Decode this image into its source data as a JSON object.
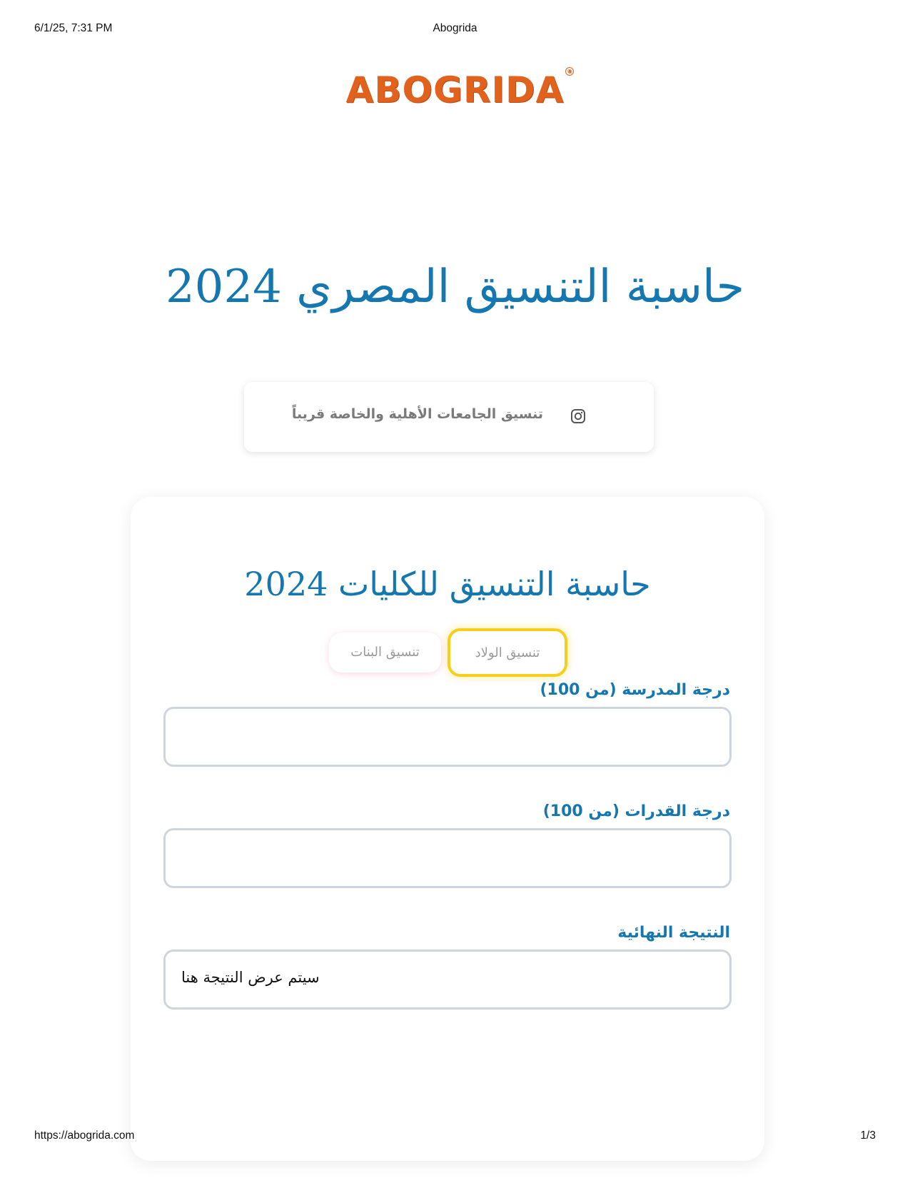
{
  "print_header": {
    "date": "6/1/25, 7:31 PM",
    "title": "Abogrida"
  },
  "print_footer": {
    "url": "https://abogrida.com",
    "page": "1/3"
  },
  "logo": {
    "text": "ABOGRIDA",
    "reg_mark": "®",
    "color": "#e0621d"
  },
  "hero": {
    "title": "حاسبة التنسيق المصري 2024"
  },
  "notice": {
    "text": "تنسيق الجامعات الأهلية والخاصة قريباً",
    "icon": "instagram-icon"
  },
  "calculator": {
    "title": "حاسبة التنسيق للكليات 2024",
    "tabs": [
      {
        "label": "تنسيق الولاد",
        "active": true
      },
      {
        "label": "تنسيق البنات",
        "active": false
      }
    ],
    "school_score": {
      "label": "درجة المدرسة (من 100)",
      "value": ""
    },
    "aptitude_score": {
      "label": "درجة القدرات (من 100)",
      "value": ""
    },
    "result": {
      "label": "النتيجة النهائية",
      "placeholder": "سيتم عرض النتيجة هنا"
    }
  },
  "colors": {
    "accent": "#1477b0",
    "active_tab_border": "#f5cf1c",
    "input_border": "#cfd5dc"
  }
}
